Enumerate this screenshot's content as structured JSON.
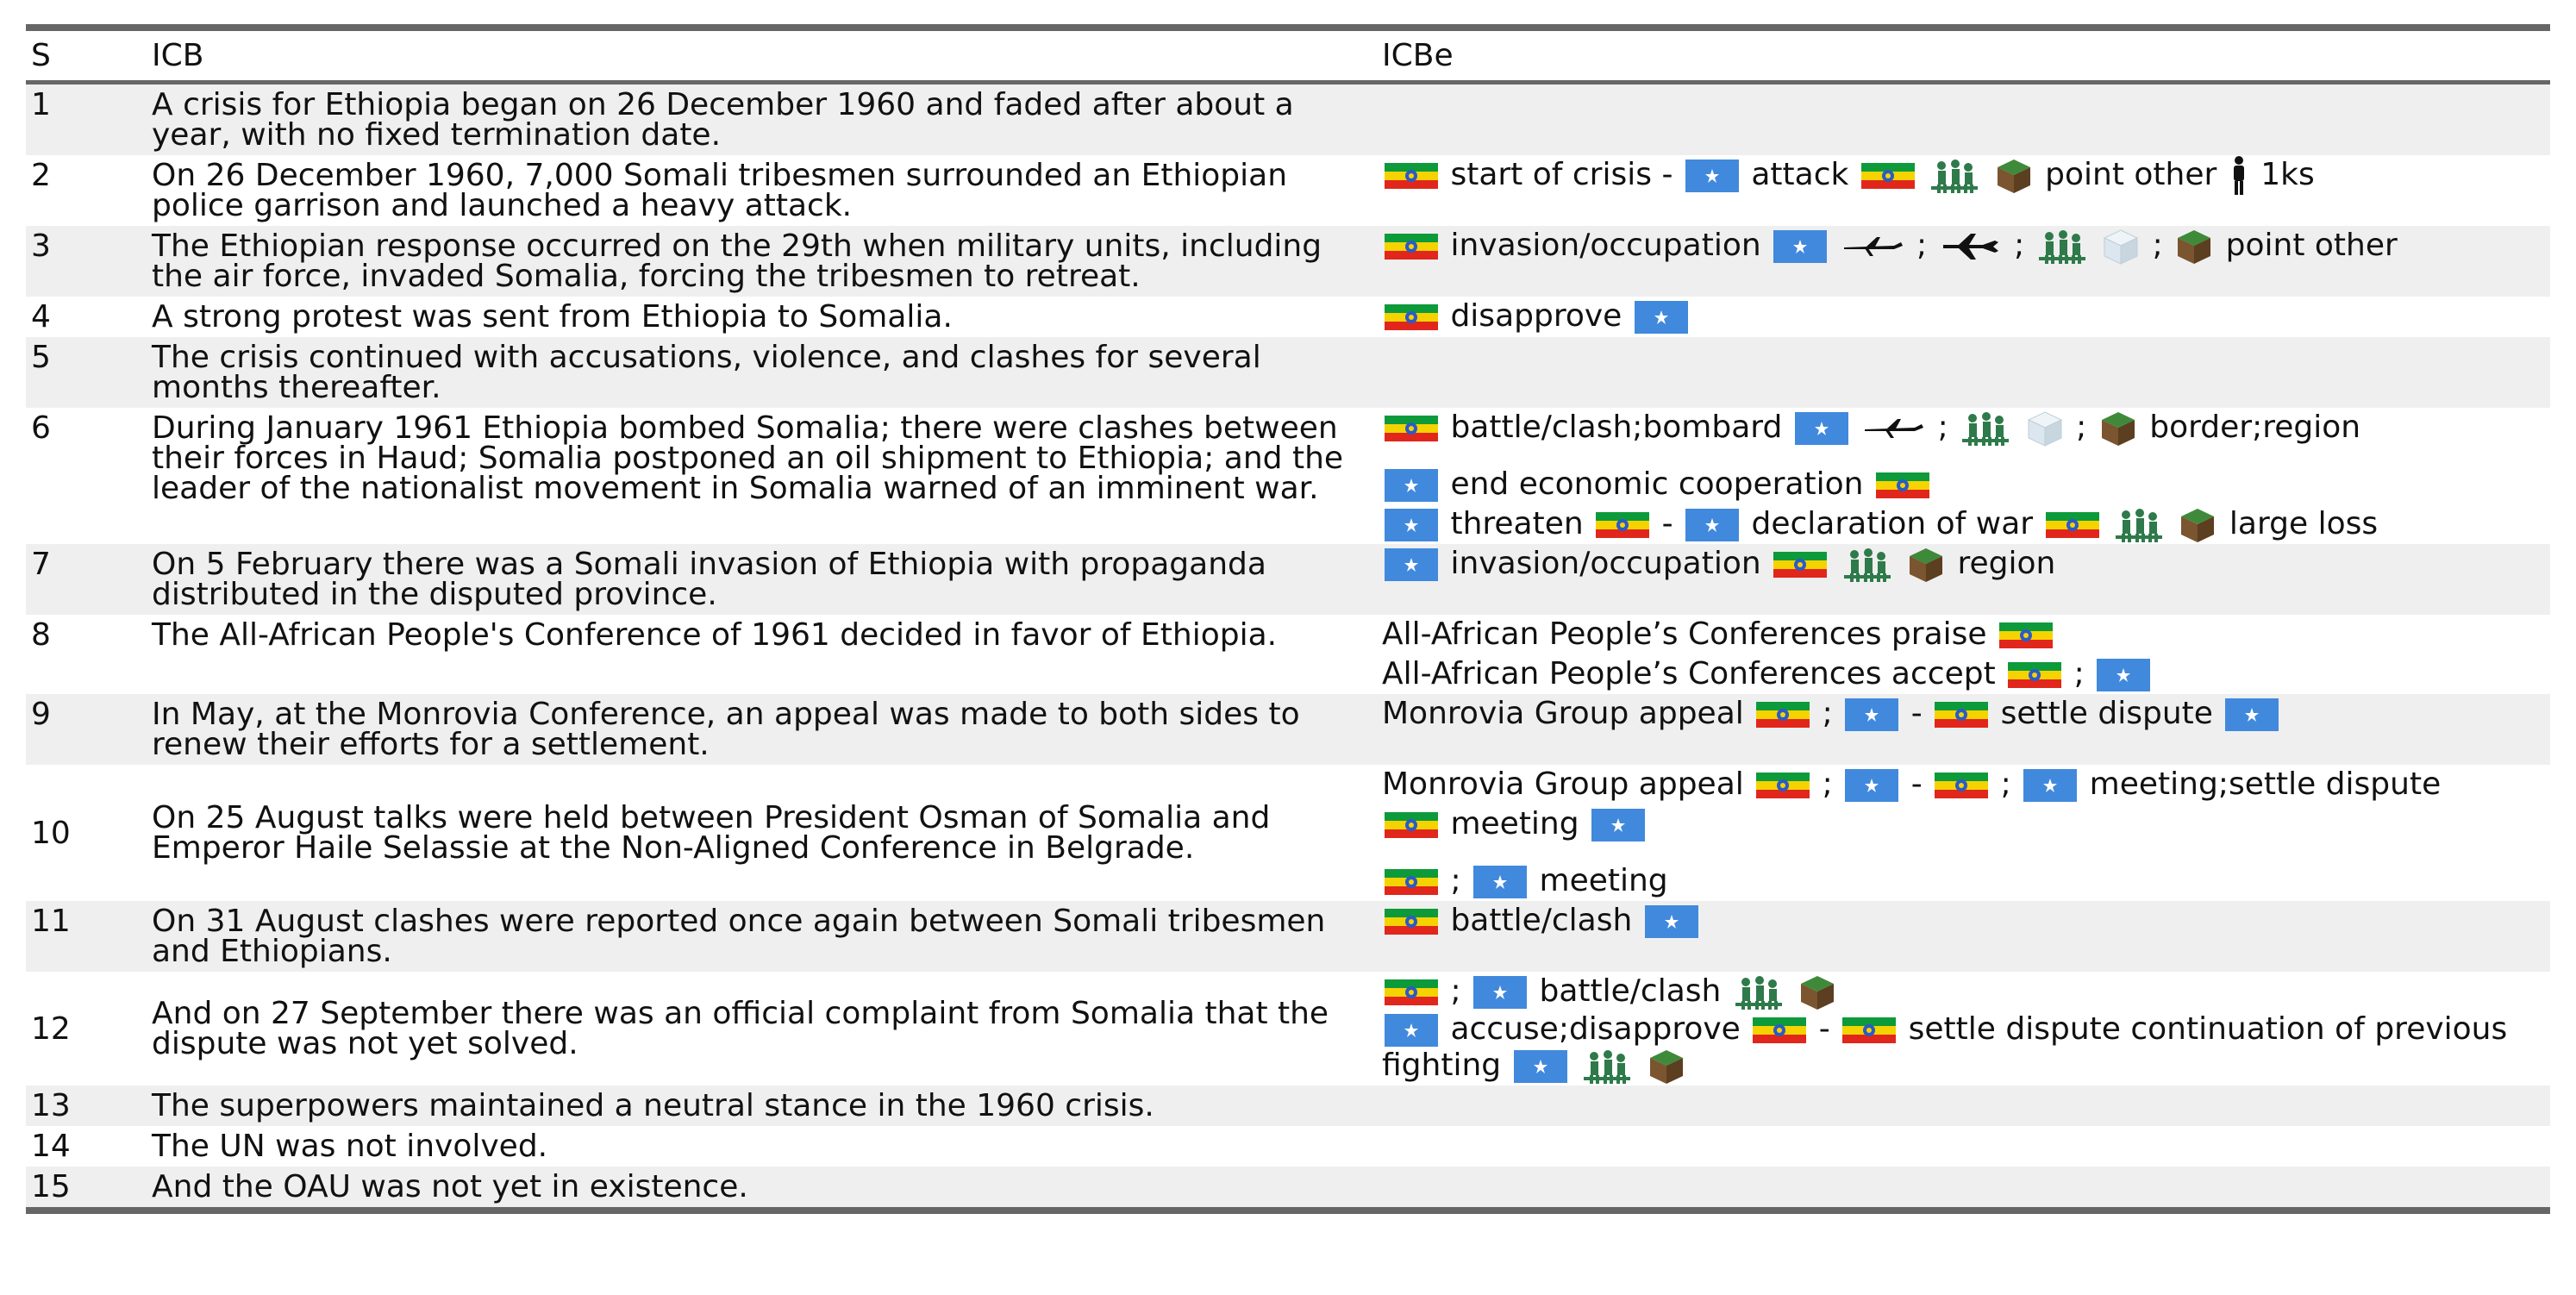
{
  "headers": {
    "s": "S",
    "icb": "ICB",
    "icbe": "ICBe"
  },
  "rows": [
    {
      "s": "1",
      "icb": "A crisis for Ethiopia began on 26 December 1960 and faded after about a year, with no fixed termination date.",
      "lines": []
    },
    {
      "s": "2",
      "icb": "On 26 December 1960, 7,000 Somali tribesmen surrounded an Ethiopian police garrison and launched a heavy attack.",
      "lines": [
        [
          {
            "k": "flag",
            "v": "ethiopia"
          },
          {
            "k": "t",
            "v": "start of crisis -"
          },
          {
            "k": "flag",
            "v": "somalia"
          },
          {
            "k": "t",
            "v": "attack"
          },
          {
            "k": "flag",
            "v": "ethiopia"
          },
          {
            "k": "icon",
            "v": "soldiers"
          },
          {
            "k": "icon",
            "v": "land-cube"
          },
          {
            "k": "t",
            "v": "point other"
          },
          {
            "k": "icon",
            "v": "person"
          },
          {
            "k": "t",
            "v": "1ks"
          }
        ]
      ]
    },
    {
      "s": "3",
      "icb": "The Ethiopian response occurred on the 29th when military units, including the air force, invaded Somalia, forcing the tribesmen to retreat.",
      "lines": [
        [
          {
            "k": "flag",
            "v": "ethiopia"
          },
          {
            "k": "t",
            "v": "invasion/occupation"
          },
          {
            "k": "flag",
            "v": "somalia"
          },
          {
            "k": "icon",
            "v": "plane"
          },
          {
            "k": "t",
            "v": ";"
          },
          {
            "k": "icon",
            "v": "jet"
          },
          {
            "k": "t",
            "v": ";"
          },
          {
            "k": "icon",
            "v": "soldiers"
          },
          {
            "k": "icon",
            "v": "water-cube"
          },
          {
            "k": "t",
            "v": ";"
          },
          {
            "k": "icon",
            "v": "land-cube"
          },
          {
            "k": "t",
            "v": "point other"
          }
        ]
      ]
    },
    {
      "s": "4",
      "icb": "A strong protest was sent from Ethiopia to Somalia.",
      "lines": [
        [
          {
            "k": "flag",
            "v": "ethiopia"
          },
          {
            "k": "t",
            "v": "disapprove"
          },
          {
            "k": "flag",
            "v": "somalia"
          }
        ]
      ]
    },
    {
      "s": "5",
      "icb": "The crisis continued with accusations, violence, and clashes for several months thereafter.",
      "lines": []
    },
    {
      "s": "6",
      "icb": "During January 1961 Ethiopia bombed Somalia; there were clashes between their forces in Haud; Somalia postponed an oil shipment to Ethiopia; and the leader of the nationalist movement in Somalia warned of an imminent war.",
      "lines": [
        [
          {
            "k": "flag",
            "v": "ethiopia"
          },
          {
            "k": "t",
            "v": "battle/clash;bombard"
          },
          {
            "k": "flag",
            "v": "somalia"
          },
          {
            "k": "icon",
            "v": "plane"
          },
          {
            "k": "t",
            "v": ";"
          },
          {
            "k": "icon",
            "v": "soldiers"
          },
          {
            "k": "icon",
            "v": "water-cube"
          },
          {
            "k": "t",
            "v": ";"
          },
          {
            "k": "icon",
            "v": "land-cube"
          },
          {
            "k": "t",
            "v": "border;region"
          }
        ],
        "gap",
        [
          {
            "k": "flag",
            "v": "somalia"
          },
          {
            "k": "t",
            "v": "end economic cooperation"
          },
          {
            "k": "flag",
            "v": "ethiopia"
          }
        ],
        [
          {
            "k": "flag",
            "v": "somalia"
          },
          {
            "k": "t",
            "v": "threaten"
          },
          {
            "k": "flag",
            "v": "ethiopia"
          },
          {
            "k": "t",
            "v": "-"
          },
          {
            "k": "flag",
            "v": "somalia"
          },
          {
            "k": "t",
            "v": "declaration of war"
          },
          {
            "k": "flag",
            "v": "ethiopia"
          },
          {
            "k": "icon",
            "v": "soldiers"
          },
          {
            "k": "icon",
            "v": "land-cube"
          },
          {
            "k": "t",
            "v": "large loss"
          }
        ]
      ]
    },
    {
      "s": "7",
      "icb": "On 5 February there was a Somali invasion of Ethiopia with propaganda distributed in the disputed province.",
      "lines": [
        [
          {
            "k": "flag",
            "v": "somalia"
          },
          {
            "k": "t",
            "v": "invasion/occupation"
          },
          {
            "k": "flag",
            "v": "ethiopia"
          },
          {
            "k": "icon",
            "v": "soldiers"
          },
          {
            "k": "icon",
            "v": "land-cube"
          },
          {
            "k": "t",
            "v": "region"
          }
        ]
      ]
    },
    {
      "s": "8",
      "icb": "The All-African People's Conference of 1961 decided in favor of Ethiopia.",
      "lines": [
        [
          {
            "k": "t",
            "v": "All-African People’s Conferences praise"
          },
          {
            "k": "flag",
            "v": "ethiopia"
          }
        ],
        [
          {
            "k": "t",
            "v": "All-African People’s Conferences accept"
          },
          {
            "k": "flag",
            "v": "ethiopia"
          },
          {
            "k": "t",
            "v": ";"
          },
          {
            "k": "flag",
            "v": "somalia"
          }
        ]
      ]
    },
    {
      "s": "9",
      "icb": "In May, at the Monrovia Conference, an appeal was made to both sides to renew their efforts for a settlement.",
      "lines": [
        [
          {
            "k": "t",
            "v": "Monrovia Group appeal"
          },
          {
            "k": "flag",
            "v": "ethiopia"
          },
          {
            "k": "t",
            "v": ";"
          },
          {
            "k": "flag",
            "v": "somalia"
          },
          {
            "k": "t",
            "v": "-"
          },
          {
            "k": "flag",
            "v": "ethiopia"
          },
          {
            "k": "t",
            "v": "settle dispute"
          },
          {
            "k": "flag",
            "v": "somalia"
          }
        ]
      ]
    },
    {
      "s": "10",
      "icb": "On 25 August talks were held between President Osman of Somalia and Emperor Haile Selassie at the Non-Aligned Conference in Belgrade.",
      "vmid": true,
      "lines": [
        [
          {
            "k": "t",
            "v": "Monrovia Group appeal"
          },
          {
            "k": "flag",
            "v": "ethiopia"
          },
          {
            "k": "t",
            "v": ";"
          },
          {
            "k": "flag",
            "v": "somalia"
          },
          {
            "k": "t",
            "v": "-"
          },
          {
            "k": "flag",
            "v": "ethiopia"
          },
          {
            "k": "t",
            "v": ";"
          },
          {
            "k": "flag",
            "v": "somalia"
          },
          {
            "k": "t",
            "v": "meeting;settle dispute"
          }
        ],
        [
          {
            "k": "flag",
            "v": "ethiopia"
          },
          {
            "k": "t",
            "v": "meeting"
          },
          {
            "k": "flag",
            "v": "somalia"
          }
        ],
        "gap",
        [
          {
            "k": "flag",
            "v": "ethiopia"
          },
          {
            "k": "t",
            "v": ";"
          },
          {
            "k": "flag",
            "v": "somalia"
          },
          {
            "k": "t",
            "v": "meeting"
          }
        ]
      ]
    },
    {
      "s": "11",
      "icb": "On 31 August clashes were reported once again between Somali tribesmen and Ethiopians.",
      "lines": [
        [
          {
            "k": "flag",
            "v": "ethiopia"
          },
          {
            "k": "t",
            "v": "battle/clash"
          },
          {
            "k": "flag",
            "v": "somalia"
          }
        ]
      ]
    },
    {
      "s": "12",
      "icb": "And on 27 September there was an official complaint from Somalia that the dispute was not yet solved.",
      "vmid": true,
      "lines": [
        [
          {
            "k": "flag",
            "v": "ethiopia"
          },
          {
            "k": "t",
            "v": ";"
          },
          {
            "k": "flag",
            "v": "somalia"
          },
          {
            "k": "t",
            "v": "battle/clash"
          },
          {
            "k": "icon",
            "v": "soldiers"
          },
          {
            "k": "icon",
            "v": "land-cube"
          }
        ],
        {
          "wrap": true,
          "items": [
            {
              "k": "flag",
              "v": "somalia"
            },
            {
              "k": "t",
              "v": "accuse;disapprove"
            },
            {
              "k": "flag",
              "v": "ethiopia"
            },
            {
              "k": "t",
              "v": "-"
            },
            {
              "k": "flag",
              "v": "ethiopia"
            },
            {
              "k": "t",
              "v": "settle dispute continuation of previous fighting"
            },
            {
              "k": "flag",
              "v": "somalia"
            },
            {
              "k": "icon",
              "v": "soldiers"
            },
            {
              "k": "icon",
              "v": "land-cube"
            }
          ]
        }
      ]
    },
    {
      "s": "13",
      "icb": "The superpowers maintained a neutral stance in the 1960 crisis.",
      "lines": []
    },
    {
      "s": "14",
      "icb": "The UN was not involved.",
      "lines": []
    },
    {
      "s": "15",
      "icb": "And the OAU was not yet in existence.",
      "lines": []
    }
  ]
}
